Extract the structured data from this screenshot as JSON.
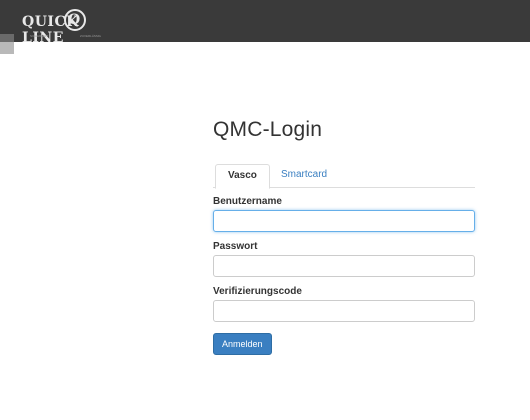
{
  "header": {
    "logo_text_left": "QUICK",
    "logo_text_q": "Q",
    "logo_text_right": "LINE",
    "logo_tag_left": "SICHERHEIT",
    "logo_tag_right": "ZUVERLÄSSIG"
  },
  "login": {
    "title": "QMC-Login",
    "tabs": [
      {
        "label": "Vasco",
        "active": true
      },
      {
        "label": "Smartcard",
        "active": false
      }
    ],
    "fields": [
      {
        "label": "Benutzername",
        "value": "",
        "placeholder": ""
      },
      {
        "label": "Passwort",
        "value": "",
        "placeholder": ""
      },
      {
        "label": "Verifizierungscode",
        "value": "",
        "placeholder": ""
      }
    ],
    "submit_label": "Anmelden"
  },
  "colors": {
    "topbar": "#3a3a3a",
    "accent": "#3a7fc1",
    "focus_border": "#66afe9"
  }
}
